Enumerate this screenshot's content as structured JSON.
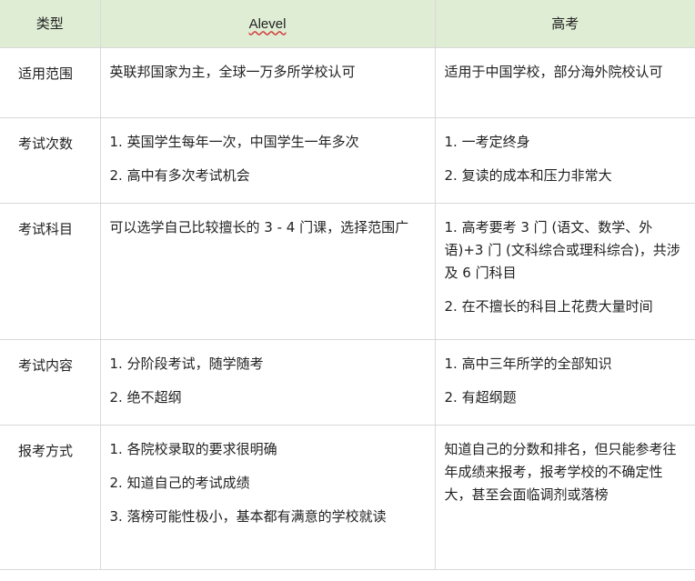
{
  "header": {
    "type_label": "类型",
    "alevel_label": "Alevel",
    "gaokao_label": "高考"
  },
  "rows": [
    {
      "type": "适用范围",
      "alevel": [
        "英联邦国家为主，全球一万多所学校认可"
      ],
      "gaokao": [
        "适用于中国学校，部分海外院校认可"
      ]
    },
    {
      "type": "考试次数",
      "alevel": [
        "1. 英国学生每年一次，中国学生一年多次",
        "2. 高中有多次考试机会"
      ],
      "gaokao": [
        "1. 一考定终身",
        "2. 复读的成本和压力非常大"
      ]
    },
    {
      "type": "考试科目",
      "alevel": [
        "可以选学自己比较擅长的 3 - 4 门课，选择范围广"
      ],
      "gaokao": [
        "1. 高考要考 3 门 (语文、数学、外语)+3 门 (文科综合或理科综合)，共涉及 6 门科目",
        "2. 在不擅长的科目上花费大量时间"
      ]
    },
    {
      "type": "考试内容",
      "alevel": [
        "1. 分阶段考试，随学随考",
        "2. 绝不超纲"
      ],
      "gaokao": [
        "1. 高中三年所学的全部知识",
        "2. 有超纲题"
      ]
    },
    {
      "type": "报考方式",
      "alevel": [
        "1. 各院校录取的要求很明确",
        "2. 知道自己的考试成绩",
        "3. 落榜可能性极小，基本都有满意的学校就读"
      ],
      "gaokao": [
        "知道自己的分数和排名，但只能参考往年成绩来报考，报考学校的不确定性大，甚至会面临调剂或落榜"
      ]
    }
  ]
}
